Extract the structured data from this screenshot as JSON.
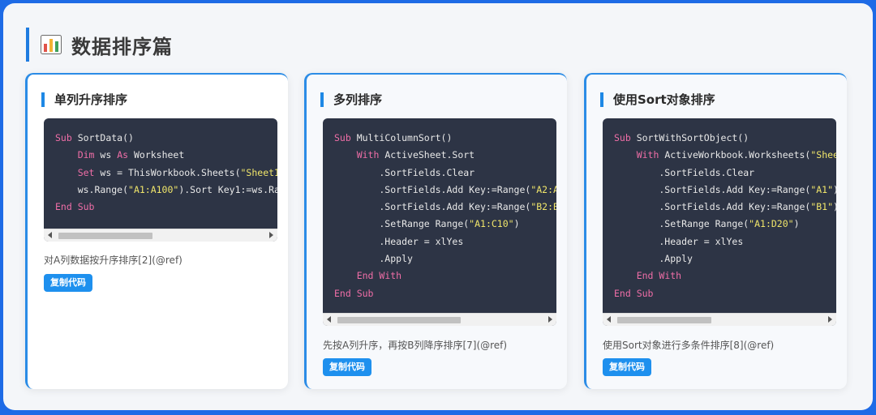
{
  "page": {
    "title": "数据排序篇",
    "icon": "bar-chart-icon"
  },
  "colors": {
    "accent": "#1e88e5",
    "background": "#1e6be6",
    "code_bg": "#2d3445",
    "keyword": "#ef6ea7",
    "string": "#f0e56a"
  },
  "cards": [
    {
      "title": "单列升序排序",
      "code": [
        [
          {
            "t": "Sub",
            "c": "kw"
          },
          {
            "t": " SortData()"
          }
        ],
        [
          {
            "t": "    "
          },
          {
            "t": "Dim",
            "c": "kw"
          },
          {
            "t": " ws "
          },
          {
            "t": "As",
            "c": "kw"
          },
          {
            "t": " Worksheet"
          }
        ],
        [
          {
            "t": "    "
          },
          {
            "t": "Set",
            "c": "kw"
          },
          {
            "t": " ws = ThisWorkbook.Sheets("
          },
          {
            "t": "\"Sheet1\")",
            "c": "str"
          }
        ],
        [
          {
            "t": "    ws.Range("
          },
          {
            "t": "\"A1:A100\"",
            "c": "str"
          },
          {
            "t": ").Sort Key1:=ws.Range(\"A1\"), Order1:=xlAscending"
          }
        ],
        [
          {
            "t": "End Sub",
            "c": "kw"
          }
        ]
      ],
      "description": "对A列数据按升序排序[2](@ref)",
      "copy_label": "复制代码"
    },
    {
      "title": "多列排序",
      "code": [
        [
          {
            "t": "Sub",
            "c": "kw"
          },
          {
            "t": " MultiColumnSort()"
          }
        ],
        [
          {
            "t": "    "
          },
          {
            "t": "With",
            "c": "kw"
          },
          {
            "t": " ActiveSheet.Sort"
          }
        ],
        [
          {
            "t": "        .SortFields.Clear"
          }
        ],
        [
          {
            "t": "        .SortFields.Add Key:=Range("
          },
          {
            "t": "\"A2:A10\"",
            "c": "str"
          },
          {
            "t": "), Order:=xlAscending"
          }
        ],
        [
          {
            "t": "        .SortFields.Add Key:=Range("
          },
          {
            "t": "\"B2:B10\"",
            "c": "str"
          },
          {
            "t": "), Order:=xlDescending"
          }
        ],
        [
          {
            "t": "        .SetRange Range("
          },
          {
            "t": "\"A1:C10\"",
            "c": "str"
          },
          {
            "t": ")"
          }
        ],
        [
          {
            "t": "        .Header = xlYes"
          }
        ],
        [
          {
            "t": "        .Apply"
          }
        ],
        [
          {
            "t": "    "
          },
          {
            "t": "End With",
            "c": "kw"
          }
        ],
        [
          {
            "t": "End Sub",
            "c": "kw"
          }
        ]
      ],
      "description": "先按A列升序，再按B列降序排序[7](@ref)",
      "copy_label": "复制代码"
    },
    {
      "title": "使用Sort对象排序",
      "code": [
        [
          {
            "t": "Sub",
            "c": "kw"
          },
          {
            "t": " SortWithSortObject()"
          }
        ],
        [
          {
            "t": "    "
          },
          {
            "t": "With",
            "c": "kw"
          },
          {
            "t": " ActiveWorkbook.Worksheets("
          },
          {
            "t": "\"Sheet1\"",
            "c": "str"
          },
          {
            "t": ").Sort"
          }
        ],
        [
          {
            "t": "        .SortFields.Clear"
          }
        ],
        [
          {
            "t": "        .SortFields.Add Key:=Range("
          },
          {
            "t": "\"A1\"",
            "c": "str"
          },
          {
            "t": "), Order:=xlAscending"
          }
        ],
        [
          {
            "t": "        .SortFields.Add Key:=Range("
          },
          {
            "t": "\"B1\"",
            "c": "str"
          },
          {
            "t": "), Order:=xlDescending"
          }
        ],
        [
          {
            "t": "        .SetRange Range("
          },
          {
            "t": "\"A1:D20\"",
            "c": "str"
          },
          {
            "t": ")"
          }
        ],
        [
          {
            "t": "        .Header = xlYes"
          }
        ],
        [
          {
            "t": "        .Apply"
          }
        ],
        [
          {
            "t": "    "
          },
          {
            "t": "End With",
            "c": "kw"
          }
        ],
        [
          {
            "t": "End Sub",
            "c": "kw"
          }
        ]
      ],
      "description": "使用Sort对象进行多条件排序[8](@ref)",
      "copy_label": "复制代码"
    }
  ]
}
